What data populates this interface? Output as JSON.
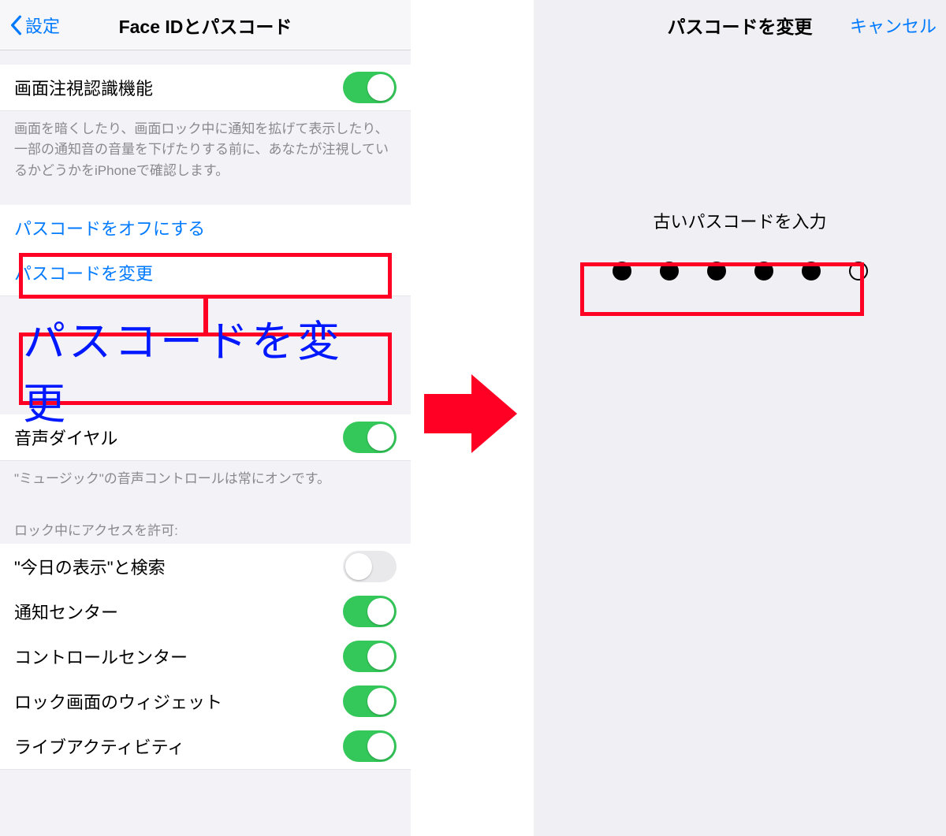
{
  "left": {
    "back_label": "設定",
    "title": "Face IDとパスコード",
    "attention": {
      "label": "画面注視認識機能",
      "on": true,
      "footer": "画面を暗くしたり、画面ロック中に通知を拡げて表示したり、一部の通知音の音量を下げたりする前に、あなたが注視しているかどうかをiPhoneで確認します。"
    },
    "passcode_off": "パスコードをオフにする",
    "passcode_change": "パスコードを変更",
    "callout_text": "パスコードを変更",
    "voice_dial": {
      "label": "音声ダイヤル",
      "on": true,
      "footer": "\"ミュージック\"の音声コントロールは常にオンです。"
    },
    "lock_header": "ロック中にアクセスを許可:",
    "lock_items": [
      {
        "label": "\"今日の表示\"と検索",
        "on": false
      },
      {
        "label": "通知センター",
        "on": true
      },
      {
        "label": "コントロールセンター",
        "on": true
      },
      {
        "label": "ロック画面のウィジェット",
        "on": true
      },
      {
        "label": "ライブアクティビティ",
        "on": true
      }
    ]
  },
  "right": {
    "title": "パスコードを変更",
    "cancel": "キャンセル",
    "prompt": "古いパスコードを入力",
    "dots_total": 6,
    "dots_filled": 5
  },
  "colors": {
    "ios_blue": "#007aff",
    "toggle_green": "#34c759",
    "annot_red": "#ff0024",
    "callout_blue": "#0018ff"
  }
}
